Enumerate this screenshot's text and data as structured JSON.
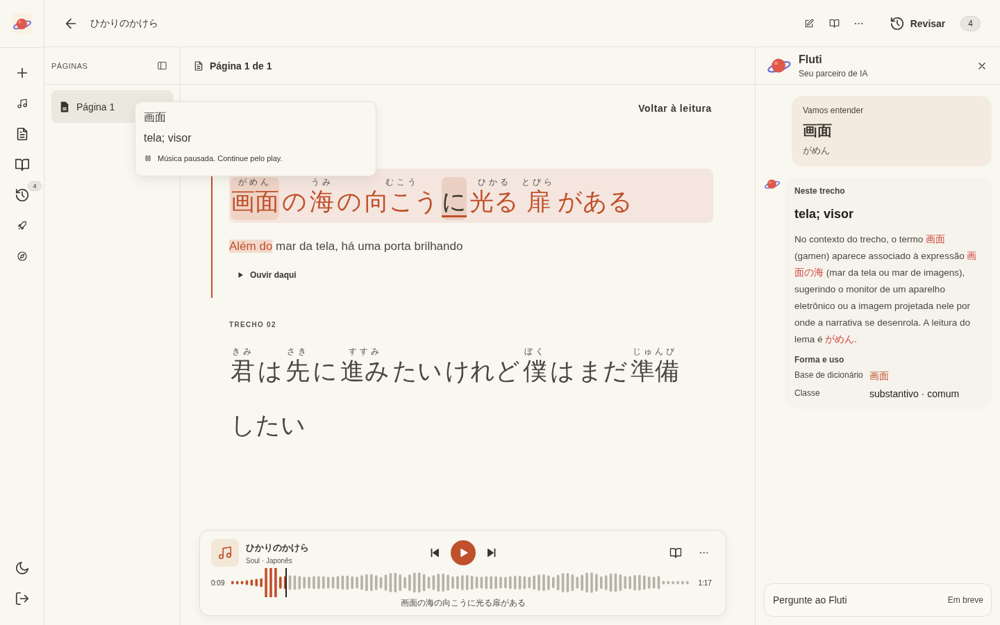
{
  "rail": {
    "review_badge": "4"
  },
  "topbar": {
    "title": "ひかりのかけら",
    "review": {
      "label": "Revisar",
      "count": "4"
    }
  },
  "pages": {
    "heading": "PÁGINAS",
    "items": [
      {
        "label": "Página 1",
        "selected": true
      }
    ]
  },
  "reader": {
    "page_label": "Página 1 de 1",
    "back_link": "Voltar à leitura",
    "passages": [
      {
        "active": true,
        "tokens": [
          {
            "text": "画面",
            "ruby": "がめん",
            "selected": true,
            "current": false
          },
          {
            "text": "の",
            "selected": false,
            "current": false
          },
          {
            "text": "海",
            "ruby": "うみ",
            "selected": false,
            "current": false
          },
          {
            "text": "の",
            "selected": false,
            "current": false
          },
          {
            "text": "向こう",
            "ruby": "むこう",
            "selected": false,
            "current": false
          },
          {
            "text": "に",
            "selected": false,
            "current": true
          },
          {
            "text": "光る",
            "ruby": "ひかる",
            "selected": false,
            "current": false
          },
          {
            "text": "扉",
            "ruby": "とびら",
            "selected": false,
            "current": false
          },
          {
            "text": "がある",
            "selected": false,
            "current": false
          }
        ],
        "translation": [
          {
            "text": "Além do",
            "highlight": true
          },
          {
            "text": " mar da tela, há uma porta brilhando",
            "highlight": false
          }
        ],
        "listen": "Ouvir daqui"
      },
      {
        "active": false,
        "label": "TRECHO 02",
        "tokens": [
          {
            "text": "君",
            "ruby": "きみ",
            "selected": false,
            "current": false
          },
          {
            "text": "は",
            "selected": false,
            "current": false
          },
          {
            "text": "先",
            "ruby": "さき",
            "selected": false,
            "current": false
          },
          {
            "text": "に",
            "selected": false,
            "current": false
          },
          {
            "text": "進み",
            "ruby": "すすみ",
            "selected": false,
            "current": false
          },
          {
            "text": "たい",
            "selected": false,
            "current": false
          },
          {
            "text": "けれど",
            "selected": false,
            "current": false
          },
          {
            "text": "僕",
            "ruby": "ぼく",
            "selected": false,
            "current": false
          },
          {
            "text": "は",
            "selected": false,
            "current": false
          },
          {
            "text": "まだ",
            "selected": false,
            "current": false
          },
          {
            "text": "準備",
            "ruby": "じゅんび",
            "selected": false,
            "current": false
          },
          {
            "text": "したい",
            "selected": false,
            "current": false
          }
        ]
      }
    ]
  },
  "popup": {
    "word": "画面",
    "meaning": "tela; visor",
    "status": "Música pausada. Continue pelo play."
  },
  "player": {
    "title": "ひかりのかけら",
    "subtitle": "Soul · Japonês",
    "playing": false,
    "elapsed": "0:09",
    "duration": "1:17",
    "level": 0.12,
    "caption": "画面の海の向こうに光る扉がある"
  },
  "assistant": {
    "name": "Fluti",
    "subtitle": "Seu parceiro de IA",
    "query": {
      "label": "Vamos entender",
      "word": "画面",
      "reading": "がめん"
    },
    "answer": {
      "label": "Neste trecho",
      "meaning": "tela; visor",
      "explanation": [
        {
          "text": "No contexto do trecho, o termo ",
          "accent": false
        },
        {
          "text": "画面",
          "accent": true
        },
        {
          "text": " (gamen) aparece associado à expressão ",
          "accent": false
        },
        {
          "text": "画面の海",
          "accent": true
        },
        {
          "text": " (mar da tela ou mar de imagens), sugerindo o monitor de um aparelho eletrônico ou a imagem projetada nele por onde a narrativa se desenrola. A leitura do lema é ",
          "accent": false
        },
        {
          "text": "がめん",
          "accent": true
        },
        {
          "text": ".",
          "accent": false
        }
      ],
      "details_heading": "Forma e uso",
      "details": [
        {
          "label": "Base de dicionário",
          "value": "画面",
          "kind": "term"
        },
        {
          "label": "Classe",
          "value": "substantivo · comum",
          "kind": "text"
        }
      ]
    },
    "input": {
      "placeholder": "Pergunte ao Fluti",
      "note": "Em breve"
    }
  }
}
